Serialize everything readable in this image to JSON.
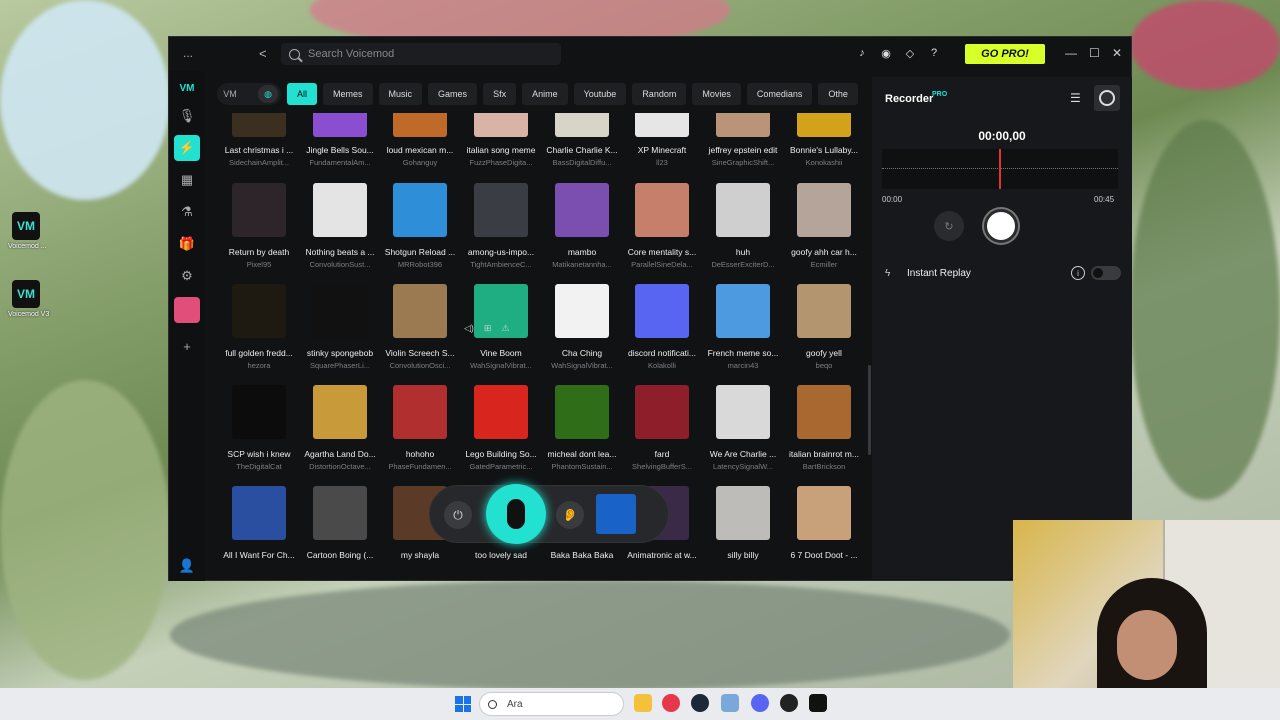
{
  "desktop": {
    "icons": [
      {
        "label": "Voicemod ..."
      },
      {
        "label": "Voicemod V3"
      }
    ]
  },
  "window": {
    "menu_glyph": "...",
    "back_glyph": "<",
    "search_placeholder": "Search Voicemod",
    "gopro_label": "GO PRO!",
    "controls": {
      "minimize": "—",
      "maximize": "☐",
      "close": "✕"
    }
  },
  "categories": [
    "All",
    "Memes",
    "Music",
    "Games",
    "Sfx",
    "Anime",
    "Youtube",
    "Random",
    "Movies",
    "Comedians",
    "Othe"
  ],
  "active_category": "All",
  "grid": {
    "rows": [
      [
        {
          "title": "Last christmas i ...",
          "author": "SidechainAmplit...",
          "color": "#3b3020"
        },
        {
          "title": "Jingle Bells Sou...",
          "author": "FundamentalAm...",
          "color": "#8a4fd0"
        },
        {
          "title": "loud mexican m...",
          "author": "Gohanguy",
          "color": "#c06a2a"
        },
        {
          "title": "italian song meme",
          "author": "FuzzPhaseDigita...",
          "color": "#d9b3a5"
        },
        {
          "title": "Charlie Charlie K...",
          "author": "BassDigitalDiffu...",
          "color": "#d8d4c8"
        },
        {
          "title": "XP Minecraft",
          "author": "ll23",
          "color": "#e6e6e6"
        },
        {
          "title": "jeffrey epstein edit",
          "author": "SineGraphicShift...",
          "color": "#b99478"
        },
        {
          "title": "Bonnie's Lullaby...",
          "author": "Konokashii",
          "color": "#d2a21b"
        }
      ],
      [
        {
          "title": "Return by death",
          "author": "Pixel95",
          "color": "#2d2529"
        },
        {
          "title": "Nothing beats a ...",
          "author": "ConvolutionSust...",
          "color": "#e4e4e4"
        },
        {
          "title": "Shotgun Reload ...",
          "author": "MRRobot396",
          "color": "#2e8fd8"
        },
        {
          "title": "among-us-impo...",
          "author": "TightAmbienceC...",
          "color": "#3a3d44"
        },
        {
          "title": "mambo",
          "author": "Matikanetannha...",
          "color": "#7a4fb0"
        },
        {
          "title": "Core mentality s...",
          "author": "ParallelSineDela...",
          "color": "#c67f6a"
        },
        {
          "title": "huh",
          "author": "DeEsserExciterD...",
          "color": "#cfcfcf"
        },
        {
          "title": "goofy ahh car h...",
          "author": "Ecmiller",
          "color": "#b5a49a"
        }
      ],
      [
        {
          "title": "full golden fredd...",
          "author": "hezora",
          "color": "#1e1a12"
        },
        {
          "title": "stinky spongebob",
          "author": "SquarePhaserLi...",
          "color": "#111111"
        },
        {
          "title": "Violin Screech S...",
          "author": "ConvolutionOsci...",
          "color": "#9b7a52"
        },
        {
          "title": "Vine Boom",
          "author": "WahSignalVibrat...",
          "color": "#1fae82"
        },
        {
          "title": "Cha Ching",
          "author": "WahSignalVibrat...",
          "color": "#f2f2f2"
        },
        {
          "title": "discord notificati...",
          "author": "Kolakolli",
          "color": "#5865f2"
        },
        {
          "title": "French meme so...",
          "author": "marcin43",
          "color": "#4d9ae0"
        },
        {
          "title": "goofy yell",
          "author": "beqo",
          "color": "#b3956f"
        }
      ],
      [
        {
          "title": "SCP wish i knew",
          "author": "TheDigitalCat",
          "color": "#0c0c0c"
        },
        {
          "title": "Agartha Land Do...",
          "author": "DistortionOctave...",
          "color": "#c99a3a"
        },
        {
          "title": "hohoho",
          "author": "PhaseFundamen...",
          "color": "#b22f2f"
        },
        {
          "title": "Lego Building So...",
          "author": "GatedParametric...",
          "color": "#d8261e"
        },
        {
          "title": "micheal dont lea...",
          "author": "PhantomSustain...",
          "color": "#2f6d18"
        },
        {
          "title": "fard",
          "author": "ShelvingBufferS...",
          "color": "#8e1f2a"
        },
        {
          "title": "We Are Charlie ...",
          "author": "LatencySignalW...",
          "color": "#d9d9d9"
        },
        {
          "title": "italian brainrot m...",
          "author": "BartBrickson",
          "color": "#a8682f"
        }
      ],
      [
        {
          "title": "All I Want For Ch...",
          "author": "",
          "color": "#2a4fa0"
        },
        {
          "title": "Cartoon Boing (...",
          "author": "",
          "color": "#4a4a4a"
        },
        {
          "title": "my shayla",
          "author": "",
          "color": "#5b3a28"
        },
        {
          "title": "too lovely sad",
          "author": "",
          "color": "#1a1b1e"
        },
        {
          "title": "Baka Baka Baka",
          "author": "",
          "color": "#1a1b1e"
        },
        {
          "title": "Animatronic at w...",
          "author": "",
          "color": "#3a2a48"
        },
        {
          "title": "silly billy",
          "author": "",
          "color": "#bdbcb8"
        },
        {
          "title": "6 7 Doot Doot - ...",
          "author": "",
          "color": "#c8a07a"
        }
      ]
    ]
  },
  "hover_actions": [
    "vol-icon",
    "add-icon",
    "report-icon"
  ],
  "dock": {
    "power": "⏻",
    "ear": "?"
  },
  "recorder": {
    "title": "Recorder",
    "pro_badge": "PRO",
    "time": "00:00,00",
    "start": "00:00",
    "end": "00:45",
    "instant_replay_label": "Instant Replay",
    "instant_replay_on": false,
    "info": "i"
  },
  "taskbar": {
    "search_text": "Ara"
  }
}
